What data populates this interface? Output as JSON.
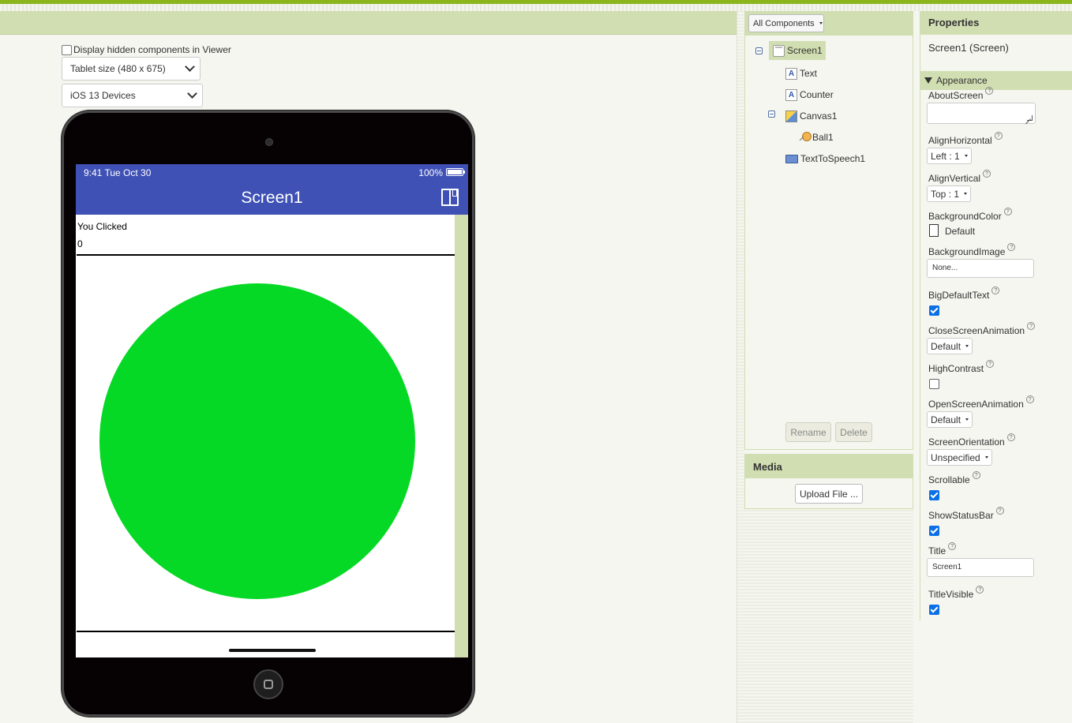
{
  "viewer": {
    "hidden_components_label": "Display hidden components in Viewer",
    "tablet_size_select": "Tablet size (480 x 675)",
    "device_select": "iOS 13 Devices"
  },
  "phone": {
    "status_time": "9:41 Tue Oct 30",
    "battery": "100%",
    "title": "Screen1",
    "label_text": "You Clicked",
    "label_counter": "0",
    "ball_color": "#06d925"
  },
  "components": {
    "filter_label": "All Components",
    "tree": [
      {
        "name": "Screen1",
        "icon": "screen-icon"
      },
      {
        "name": "Text",
        "icon": "label-icon"
      },
      {
        "name": "Counter",
        "icon": "label-icon"
      },
      {
        "name": "Canvas1",
        "icon": "canvas-icon"
      },
      {
        "name": "Ball1",
        "icon": "ball-icon"
      },
      {
        "name": "TextToSpeech1",
        "icon": "text-to-speech-icon"
      }
    ],
    "rename_label": "Rename",
    "delete_label": "Delete"
  },
  "media": {
    "header": "Media",
    "upload_label": "Upload File ..."
  },
  "properties": {
    "header": "Properties",
    "subtitle": "Screen1 (Screen)",
    "section": "Appearance",
    "about_screen": {
      "label": "AboutScreen",
      "value": ""
    },
    "align_horizontal": {
      "label": "AlignHorizontal",
      "value": "Left : 1"
    },
    "align_vertical": {
      "label": "AlignVertical",
      "value": "Top : 1"
    },
    "background_color": {
      "label": "BackgroundColor",
      "value": "Default"
    },
    "background_image": {
      "label": "BackgroundImage",
      "value": "None..."
    },
    "big_default_text": {
      "label": "BigDefaultText",
      "checked": true
    },
    "close_screen_animation": {
      "label": "CloseScreenAnimation",
      "value": "Default"
    },
    "high_contrast": {
      "label": "HighContrast",
      "checked": false
    },
    "open_screen_animation": {
      "label": "OpenScreenAnimation",
      "value": "Default"
    },
    "screen_orientation": {
      "label": "ScreenOrientation",
      "value": "Unspecified"
    },
    "scrollable": {
      "label": "Scrollable",
      "checked": true
    },
    "show_status_bar": {
      "label": "ShowStatusBar",
      "checked": true
    },
    "title": {
      "label": "Title",
      "value": "Screen1"
    },
    "title_visible": {
      "label": "TitleVisible",
      "checked": true
    },
    "help_glyph": "?"
  },
  "colors": {
    "accent_green": "#8ab51d",
    "panel_header": "#d1deb1",
    "appbar_blue": "#3f51b5"
  }
}
